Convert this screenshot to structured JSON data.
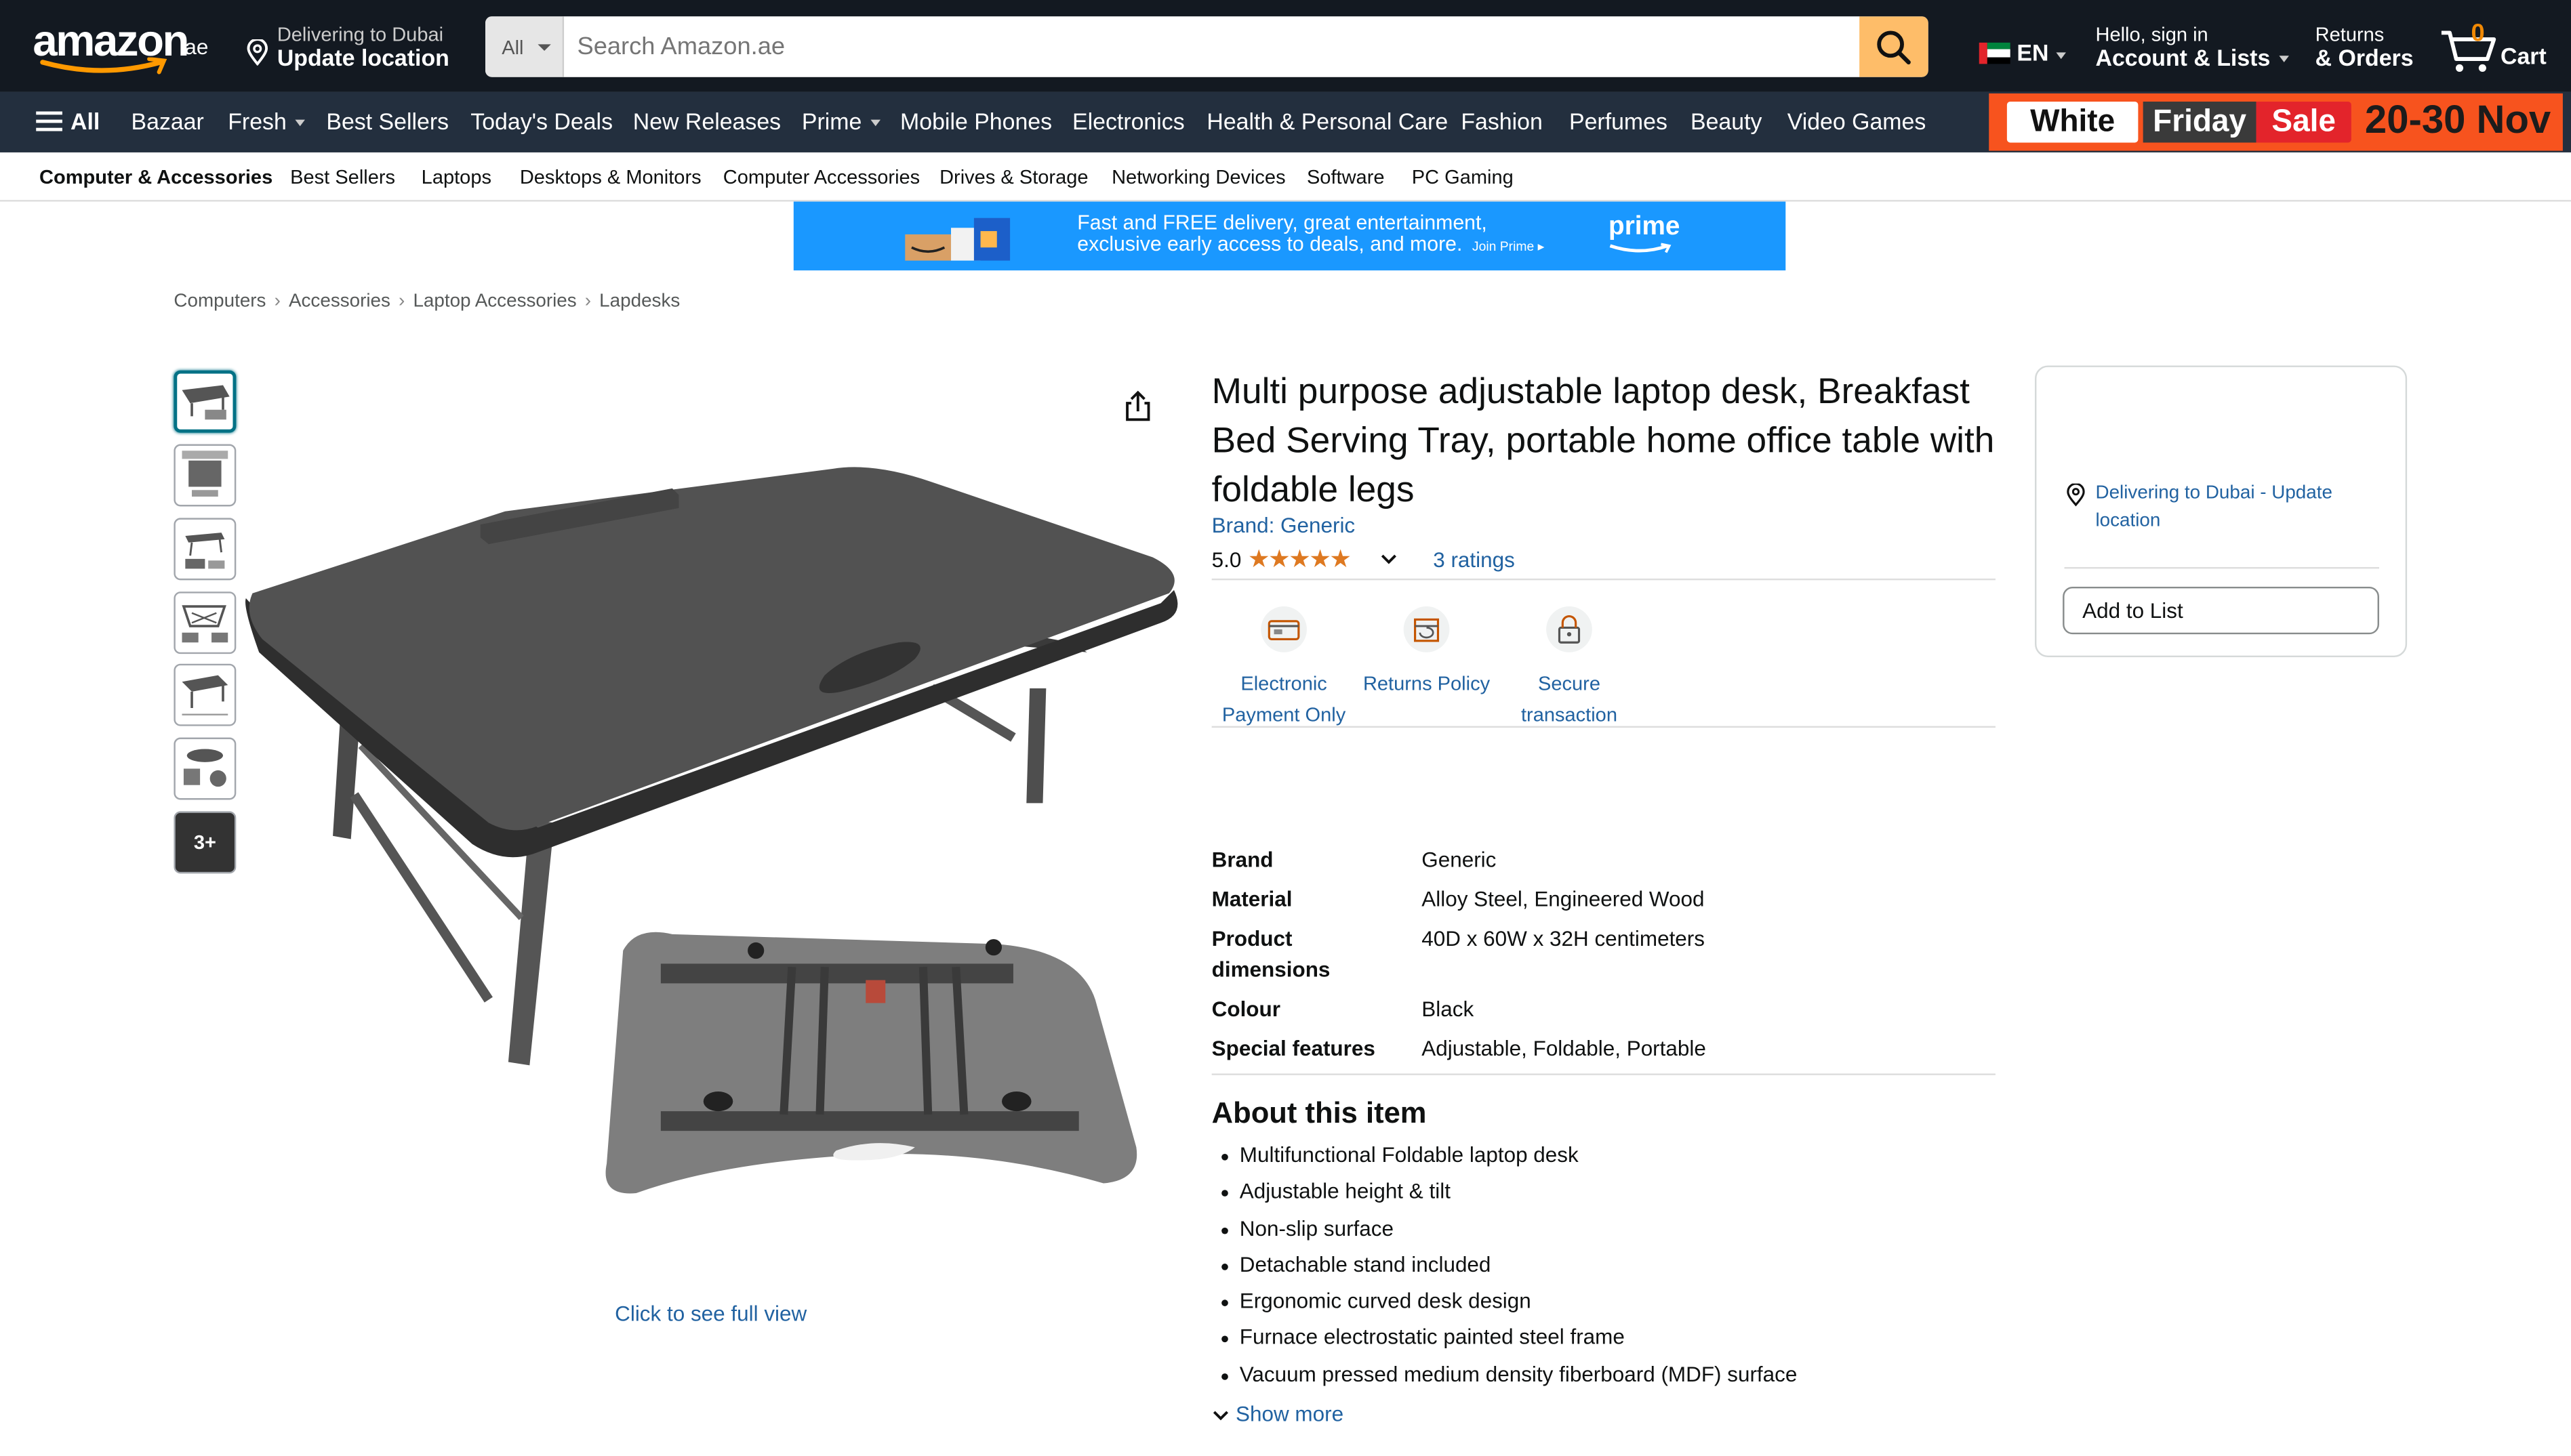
{
  "header": {
    "logo_text": "amazon",
    "logo_tld": ".ae",
    "delivery": {
      "line1": "Delivering to Dubai",
      "line2": "Update location"
    },
    "search": {
      "category": "All",
      "placeholder": "Search Amazon.ae"
    },
    "language": "EN",
    "account": {
      "line1": "Hello, sign in",
      "line2": "Account & Lists"
    },
    "returns": {
      "line1": "Returns",
      "line2": "& Orders"
    },
    "cart": {
      "count": "0",
      "label": "Cart"
    }
  },
  "nav": {
    "all_label": "All",
    "items": [
      "Bazaar",
      "Fresh",
      "Best Sellers",
      "Today's Deals",
      "New Releases",
      "Prime",
      "Mobile Phones",
      "Electronics",
      "Health & Personal Care",
      "Fashion",
      "Perfumes",
      "Beauty",
      "Video Games"
    ],
    "promo": {
      "word1": "White",
      "word2": "Friday",
      "word3": "Sale",
      "dates": "20-30 Nov"
    }
  },
  "subnav": [
    "Computer & Accessories",
    "Best Sellers",
    "Laptops",
    "Desktops & Monitors",
    "Computer Accessories",
    "Drives & Storage",
    "Networking Devices",
    "Software",
    "PC Gaming"
  ],
  "prime_banner": {
    "line1": "Fast and FREE delivery, great entertainment,",
    "line2": "exclusive early access to deals, and more.",
    "join": "Join Prime ▸",
    "brand": "prime"
  },
  "breadcrumb": [
    "Computers",
    "Accessories",
    "Laptop Accessories",
    "Lapdesks"
  ],
  "gallery": {
    "more_label": "3+",
    "full_view": "Click to see full view"
  },
  "product": {
    "title": "Multi purpose adjustable laptop desk, Breakfast Bed Serving Tray, portable home office table with foldable legs",
    "brand": "Brand: Generic",
    "rating": "5.0",
    "stars": "★★★★★",
    "ratings_count": "3 ratings",
    "features": [
      {
        "line1": "Electronic",
        "line2": "Payment Only"
      },
      {
        "line1": "Returns Policy",
        "line2": ""
      },
      {
        "line1": "Secure",
        "line2": "transaction"
      }
    ],
    "specs": [
      {
        "key": "Brand",
        "value": "Generic"
      },
      {
        "key": "Material",
        "value": "Alloy Steel, Engineered Wood"
      },
      {
        "key": "Product dimensions",
        "value": "40D x 60W x 32H centimeters"
      },
      {
        "key": "Colour",
        "value": "Black"
      },
      {
        "key": "Special features",
        "value": "Adjustable, Foldable, Portable"
      }
    ],
    "about_title": "About this item",
    "bullets": [
      "Multifunctional Foldable laptop desk",
      "Adjustable height & tilt",
      "Non-slip surface",
      "Detachable stand included",
      "Ergonomic curved desk design",
      "Furnace electrostatic painted steel frame",
      "Vacuum pressed medium density fiberboard (MDF) surface"
    ],
    "show_more": "Show more"
  },
  "buybox": {
    "delivery": "Delivering to Dubai - Update location",
    "add_to_list": "Add to List"
  },
  "colors": {
    "header_bg": "#131921",
    "nav_bg": "#232f3e",
    "search_btn": "#febd69",
    "link": "#2162a1",
    "star": "#de7921",
    "promo_bg": "#f7531e",
    "prime_bg": "#1a98ff"
  }
}
